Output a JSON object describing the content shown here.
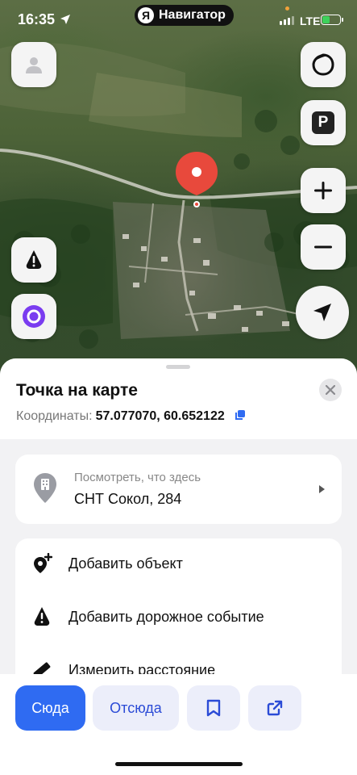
{
  "status_bar": {
    "time": "16:35",
    "app_pill": {
      "logo_letter": "Я",
      "label": "Навигатор"
    },
    "network": "LTE",
    "battery_color": "#3ed15b"
  },
  "map_controls": {
    "profile_icon": "person-icon",
    "layers_icon": "layers-icon",
    "parking_label": "P",
    "zoom_in_icon": "plus-icon",
    "zoom_out_icon": "minus-icon",
    "road_event_icon": "warning-icon",
    "alice_icon": "alice-icon",
    "locate_icon": "navigation-arrow-icon"
  },
  "pin_color": "#e8493c",
  "sheet": {
    "title": "Точка на карте",
    "coords_label": "Координаты:",
    "coords_value": "57.077070, 60.652122",
    "place": {
      "subtitle": "Посмотреть, что здесь",
      "name": "СНТ Сокол, 284"
    },
    "actions": [
      {
        "label": "Добавить объект",
        "icon": "add-place-icon"
      },
      {
        "label": "Добавить дорожное событие",
        "icon": "road-event-icon"
      },
      {
        "label": "Измерить расстояние",
        "icon": "ruler-icon"
      }
    ]
  },
  "footer": {
    "here_label": "Сюда",
    "from_label": "Отсюда",
    "bookmark_icon": "bookmark-icon",
    "share_icon": "share-icon"
  },
  "colors": {
    "accent": "#2f6bf2",
    "secondary_button_bg": "#eceefa",
    "alice_purple": "#7a3cf0"
  }
}
